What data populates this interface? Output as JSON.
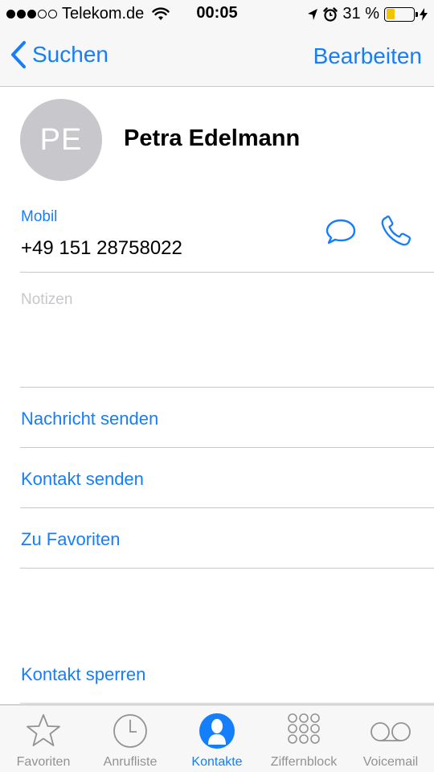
{
  "status_bar": {
    "carrier": "Telekom.de",
    "time": "00:05",
    "battery_percent": "31 %",
    "battery_level": 0.31,
    "signal_bars_filled": 3,
    "signal_bars_total": 5
  },
  "nav": {
    "back_label": "Suchen",
    "edit_label": "Bearbeiten"
  },
  "contact": {
    "initials": "PE",
    "name": "Petra Edelmann",
    "phone_label": "Mobil",
    "phone_number": "+49 151 28758022",
    "notes_placeholder": "Notizen"
  },
  "actions": {
    "send_message": "Nachricht senden",
    "share_contact": "Kontakt senden",
    "add_favorites": "Zu Favoriten",
    "block_contact": "Kontakt sperren"
  },
  "tab_bar": {
    "tabs": [
      {
        "label": "Favoriten",
        "icon": "star-icon"
      },
      {
        "label": "Anrufliste",
        "icon": "clock-icon"
      },
      {
        "label": "Kontakte",
        "icon": "person-icon"
      },
      {
        "label": "Ziffernblock",
        "icon": "keypad-icon"
      },
      {
        "label": "Voicemail",
        "icon": "voicemail-icon"
      }
    ],
    "active_index": 2
  },
  "colors": {
    "accent": "#147efb",
    "inactive": "#929292",
    "avatar_bg": "#c7c7cc",
    "battery": "#f5c400"
  }
}
